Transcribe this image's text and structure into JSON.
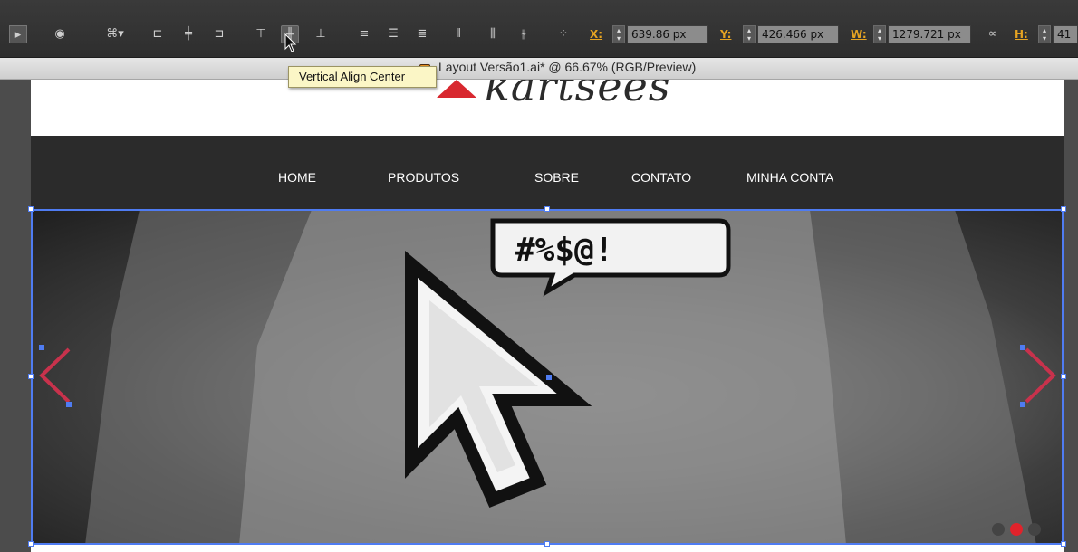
{
  "control_bar": {
    "icons": [
      "play-panel-icon",
      "recolor-artwork-icon",
      "transform-options-icon",
      "horizontal-align-left-icon",
      "horizontal-align-center-icon",
      "horizontal-align-right-icon",
      "vertical-align-top-icon",
      "vertical-align-center-icon",
      "vertical-align-bottom-icon",
      "vertical-distribute-top-icon",
      "vertical-distribute-center-icon",
      "vertical-distribute-bottom-icon",
      "horizontal-distribute-left-icon",
      "horizontal-distribute-center-icon",
      "horizontal-distribute-right-icon",
      "reference-point-icon"
    ],
    "x": {
      "label": "X:",
      "value": "639.86 px"
    },
    "y": {
      "label": "Y:",
      "value": "426.466 px"
    },
    "w": {
      "label": "W:",
      "value": "1279.721 px"
    },
    "h": {
      "label": "H:",
      "value": "41"
    },
    "link_icon": "constrain-link-icon",
    "accent_label_color": "#e5a322"
  },
  "tooltip": {
    "text": "Vertical Align Center"
  },
  "document": {
    "title": "Layout Versão1.ai* @ 66.67% (RGB/Preview)"
  },
  "site": {
    "logo_text": "kartsees",
    "nav": [
      "HOME",
      "PRODUTOS",
      "SOBRE",
      "CONTATO",
      "MINHA CONTA"
    ],
    "hero": {
      "alt": "T-shirt with pixel cursor and #@$ speech bubble",
      "prev_arrow_color": "#c8324c",
      "next_arrow_color": "#c8324c",
      "active_dot_color": "#e0232b",
      "inactive_dot_color": "#444444",
      "bubble_text": "#%$@!"
    }
  },
  "selection": {
    "color": "#4f7cf2"
  }
}
